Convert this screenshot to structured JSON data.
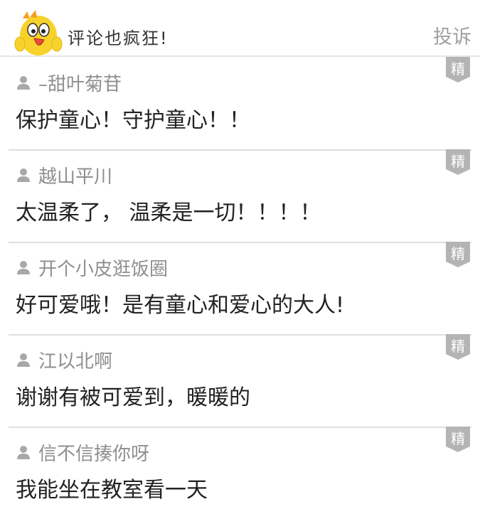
{
  "header": {
    "title": "评论也疯狂!",
    "report_label": "投诉"
  },
  "colors": {
    "badge_bg": "#b4b4b4",
    "username": "#8f8f8f",
    "comment_text": "#222222",
    "mascot_yellow": "#f7d22a"
  },
  "icons": {
    "mascot": "chick-mascot-icon",
    "user": "user-icon",
    "badge": "featured-badge-icon"
  },
  "comments": [
    {
      "user": "–甜叶菊苷",
      "text": "保护童心！守护童心！！",
      "badge": "精"
    },
    {
      "user": "越山平川",
      "text": "太温柔了， 温柔是一切！！！！",
      "badge": "精"
    },
    {
      "user": "开个小皮逛饭圈",
      "text": "好可爱哦！是有童心和爱心的大人!",
      "badge": "精"
    },
    {
      "user": "江以北啊",
      "text": "谢谢有被可爱到，暖暖的",
      "badge": "精"
    },
    {
      "user": "信不信揍你呀",
      "text": "我能坐在教室看一天",
      "badge": "精"
    }
  ]
}
